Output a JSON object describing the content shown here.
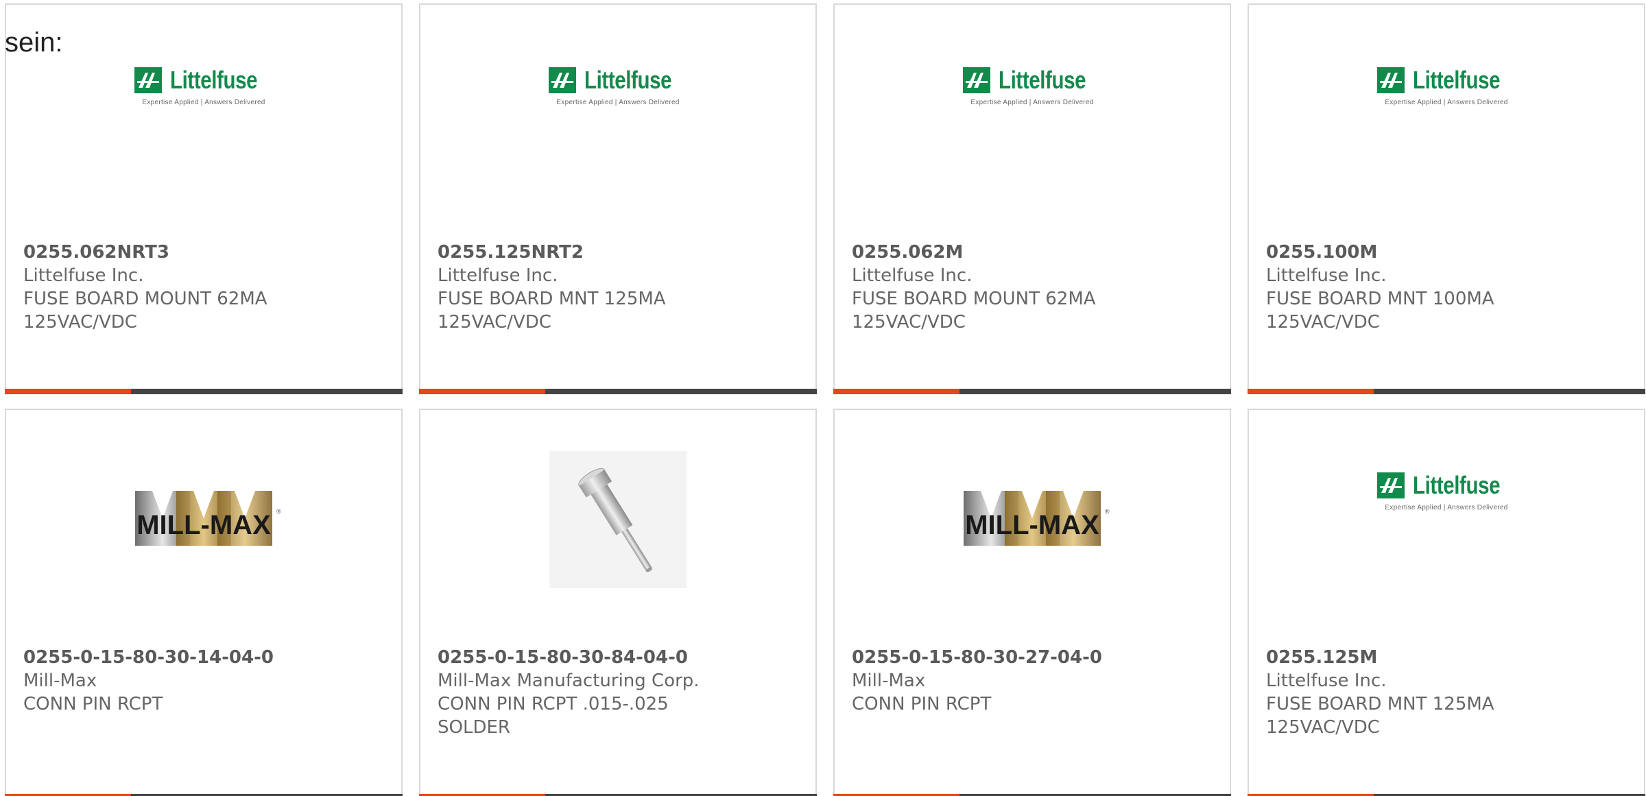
{
  "intro_text": "sein:",
  "logo_text": {
    "littelfuse_name": "Littelfuse",
    "littelfuse_tagline": "Expertise Applied | Answers Delivered",
    "millmax_name": "MILL-MAX"
  },
  "colors": {
    "accent": "#e8451e",
    "bar": "#444444",
    "littelfuse_green": "#138a4b",
    "text": "#666666"
  },
  "products": [
    {
      "part_number": "0255.062NRT3",
      "manufacturer": "Littelfuse Inc.",
      "description_line1": "FUSE BOARD MOUNT 62MA",
      "description_line2": "125VAC/VDC",
      "image": "littelfuse-logo"
    },
    {
      "part_number": "0255.125NRT2",
      "manufacturer": "Littelfuse Inc.",
      "description_line1": "FUSE BOARD MNT 125MA",
      "description_line2": "125VAC/VDC",
      "image": "littelfuse-logo"
    },
    {
      "part_number": "0255.062M",
      "manufacturer": "Littelfuse Inc.",
      "description_line1": "FUSE BOARD MOUNT 62MA",
      "description_line2": "125VAC/VDC",
      "image": "littelfuse-logo"
    },
    {
      "part_number": "0255.100M",
      "manufacturer": "Littelfuse Inc.",
      "description_line1": "FUSE BOARD MNT 100MA",
      "description_line2": "125VAC/VDC",
      "image": "littelfuse-logo"
    },
    {
      "part_number": "0255-0-15-80-30-14-04-0",
      "manufacturer": "Mill-Max",
      "description_line1": "CONN PIN RCPT",
      "description_line2": "",
      "image": "millmax-logo"
    },
    {
      "part_number": "0255-0-15-80-30-84-04-0",
      "manufacturer": "Mill-Max Manufacturing Corp.",
      "description_line1": "CONN PIN RCPT .015-.025",
      "description_line2": "SOLDER",
      "image": "pin-photo"
    },
    {
      "part_number": "0255-0-15-80-30-27-04-0",
      "manufacturer": "Mill-Max",
      "description_line1": "CONN PIN RCPT",
      "description_line2": "",
      "image": "millmax-logo"
    },
    {
      "part_number": "0255.125M",
      "manufacturer": "Littelfuse Inc.",
      "description_line1": "FUSE BOARD MNT 125MA",
      "description_line2": "125VAC/VDC",
      "image": "littelfuse-logo"
    }
  ]
}
